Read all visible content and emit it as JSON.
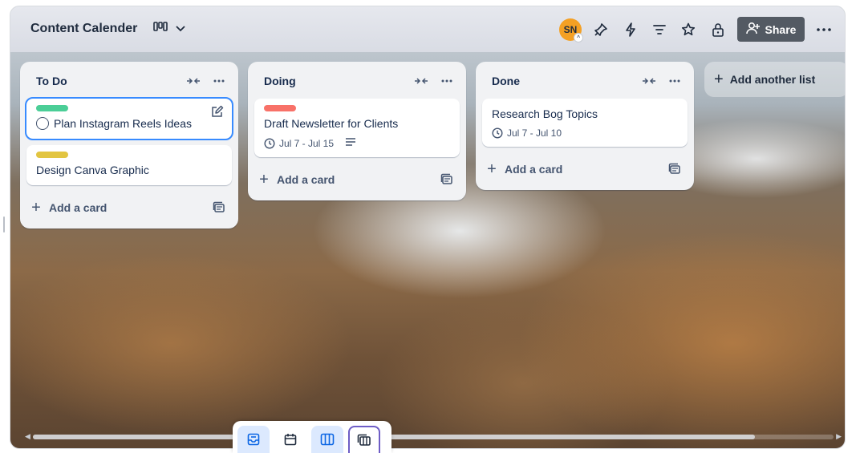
{
  "board": {
    "title": "Content Calender",
    "share_label": "Share",
    "avatar_initials": "SN",
    "accent_color": "#f4a024"
  },
  "header_icons": [
    "board-view-icon",
    "chevron-down-icon",
    "power-ups-icon",
    "automation-icon",
    "filter-icon",
    "star-icon",
    "visibility-lock-icon",
    "add-member-icon",
    "more-icon"
  ],
  "lists": [
    {
      "title": "To Do",
      "cards": [
        {
          "label_color": "#4bce97",
          "title": "Plan Instagram Reels Ideas",
          "has_checkbox": true,
          "dates": "",
          "focused": true
        },
        {
          "label_color": "#e2c541",
          "title": "Design Canva Graphic",
          "has_checkbox": false,
          "dates": ""
        }
      ],
      "add_card_label": "Add a card"
    },
    {
      "title": "Doing",
      "cards": [
        {
          "label_color": "#f87168",
          "title": "Draft Newsletter for Clients",
          "dates": "Jul 7 - Jul 15",
          "has_description": true
        }
      ],
      "add_card_label": "Add a card"
    },
    {
      "title": "Done",
      "cards": [
        {
          "title": "Research Bog Topics",
          "dates": "Jul 7 - Jul 10"
        }
      ],
      "add_card_label": "Add a card"
    }
  ],
  "add_list_label": "Add another list",
  "dock": {
    "items": [
      "inbox-icon",
      "calendar-icon",
      "board-icon",
      "switch-boards-icon"
    ]
  }
}
